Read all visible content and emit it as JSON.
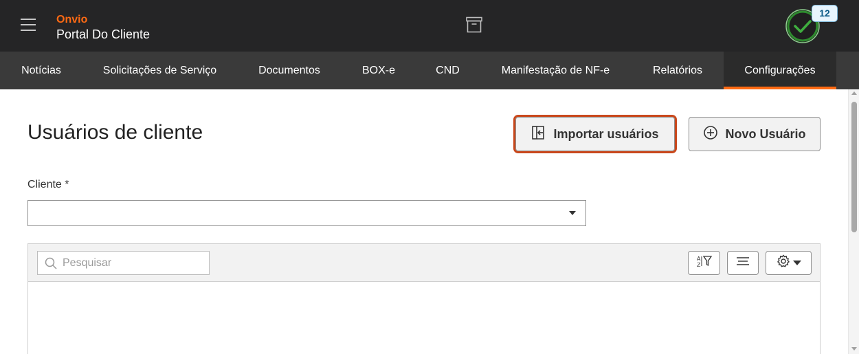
{
  "header": {
    "brand_name": "Onvio",
    "brand_subtitle": "Portal Do Cliente",
    "notification_count": "12",
    "menu_icon": "hamburger-menu-icon",
    "center_icon": "archive-box-icon",
    "status_icon": "check-circle-icon"
  },
  "nav": {
    "tabs": [
      {
        "label": "Notícias",
        "active": false
      },
      {
        "label": "Solicitações de Serviço",
        "active": false
      },
      {
        "label": "Documentos",
        "active": false
      },
      {
        "label": "BOX-e",
        "active": false
      },
      {
        "label": "CND",
        "active": false
      },
      {
        "label": "Manifestação de NF-e",
        "active": false
      },
      {
        "label": "Relatórios",
        "active": false
      },
      {
        "label": "Configurações",
        "active": true
      }
    ]
  },
  "page": {
    "title": "Usuários de cliente",
    "import_button": "Importar usuários",
    "new_user_button": "Novo Usuário"
  },
  "form": {
    "client_label": "Cliente *",
    "client_value": ""
  },
  "grid": {
    "search_placeholder": "Pesquisar",
    "search_value": ""
  },
  "colors": {
    "accent": "#ff6a13",
    "topbar": "#252526",
    "navbar": "#3a3a3a",
    "highlight_outline": "#c9481c",
    "status_green": "#2e8b2e"
  }
}
